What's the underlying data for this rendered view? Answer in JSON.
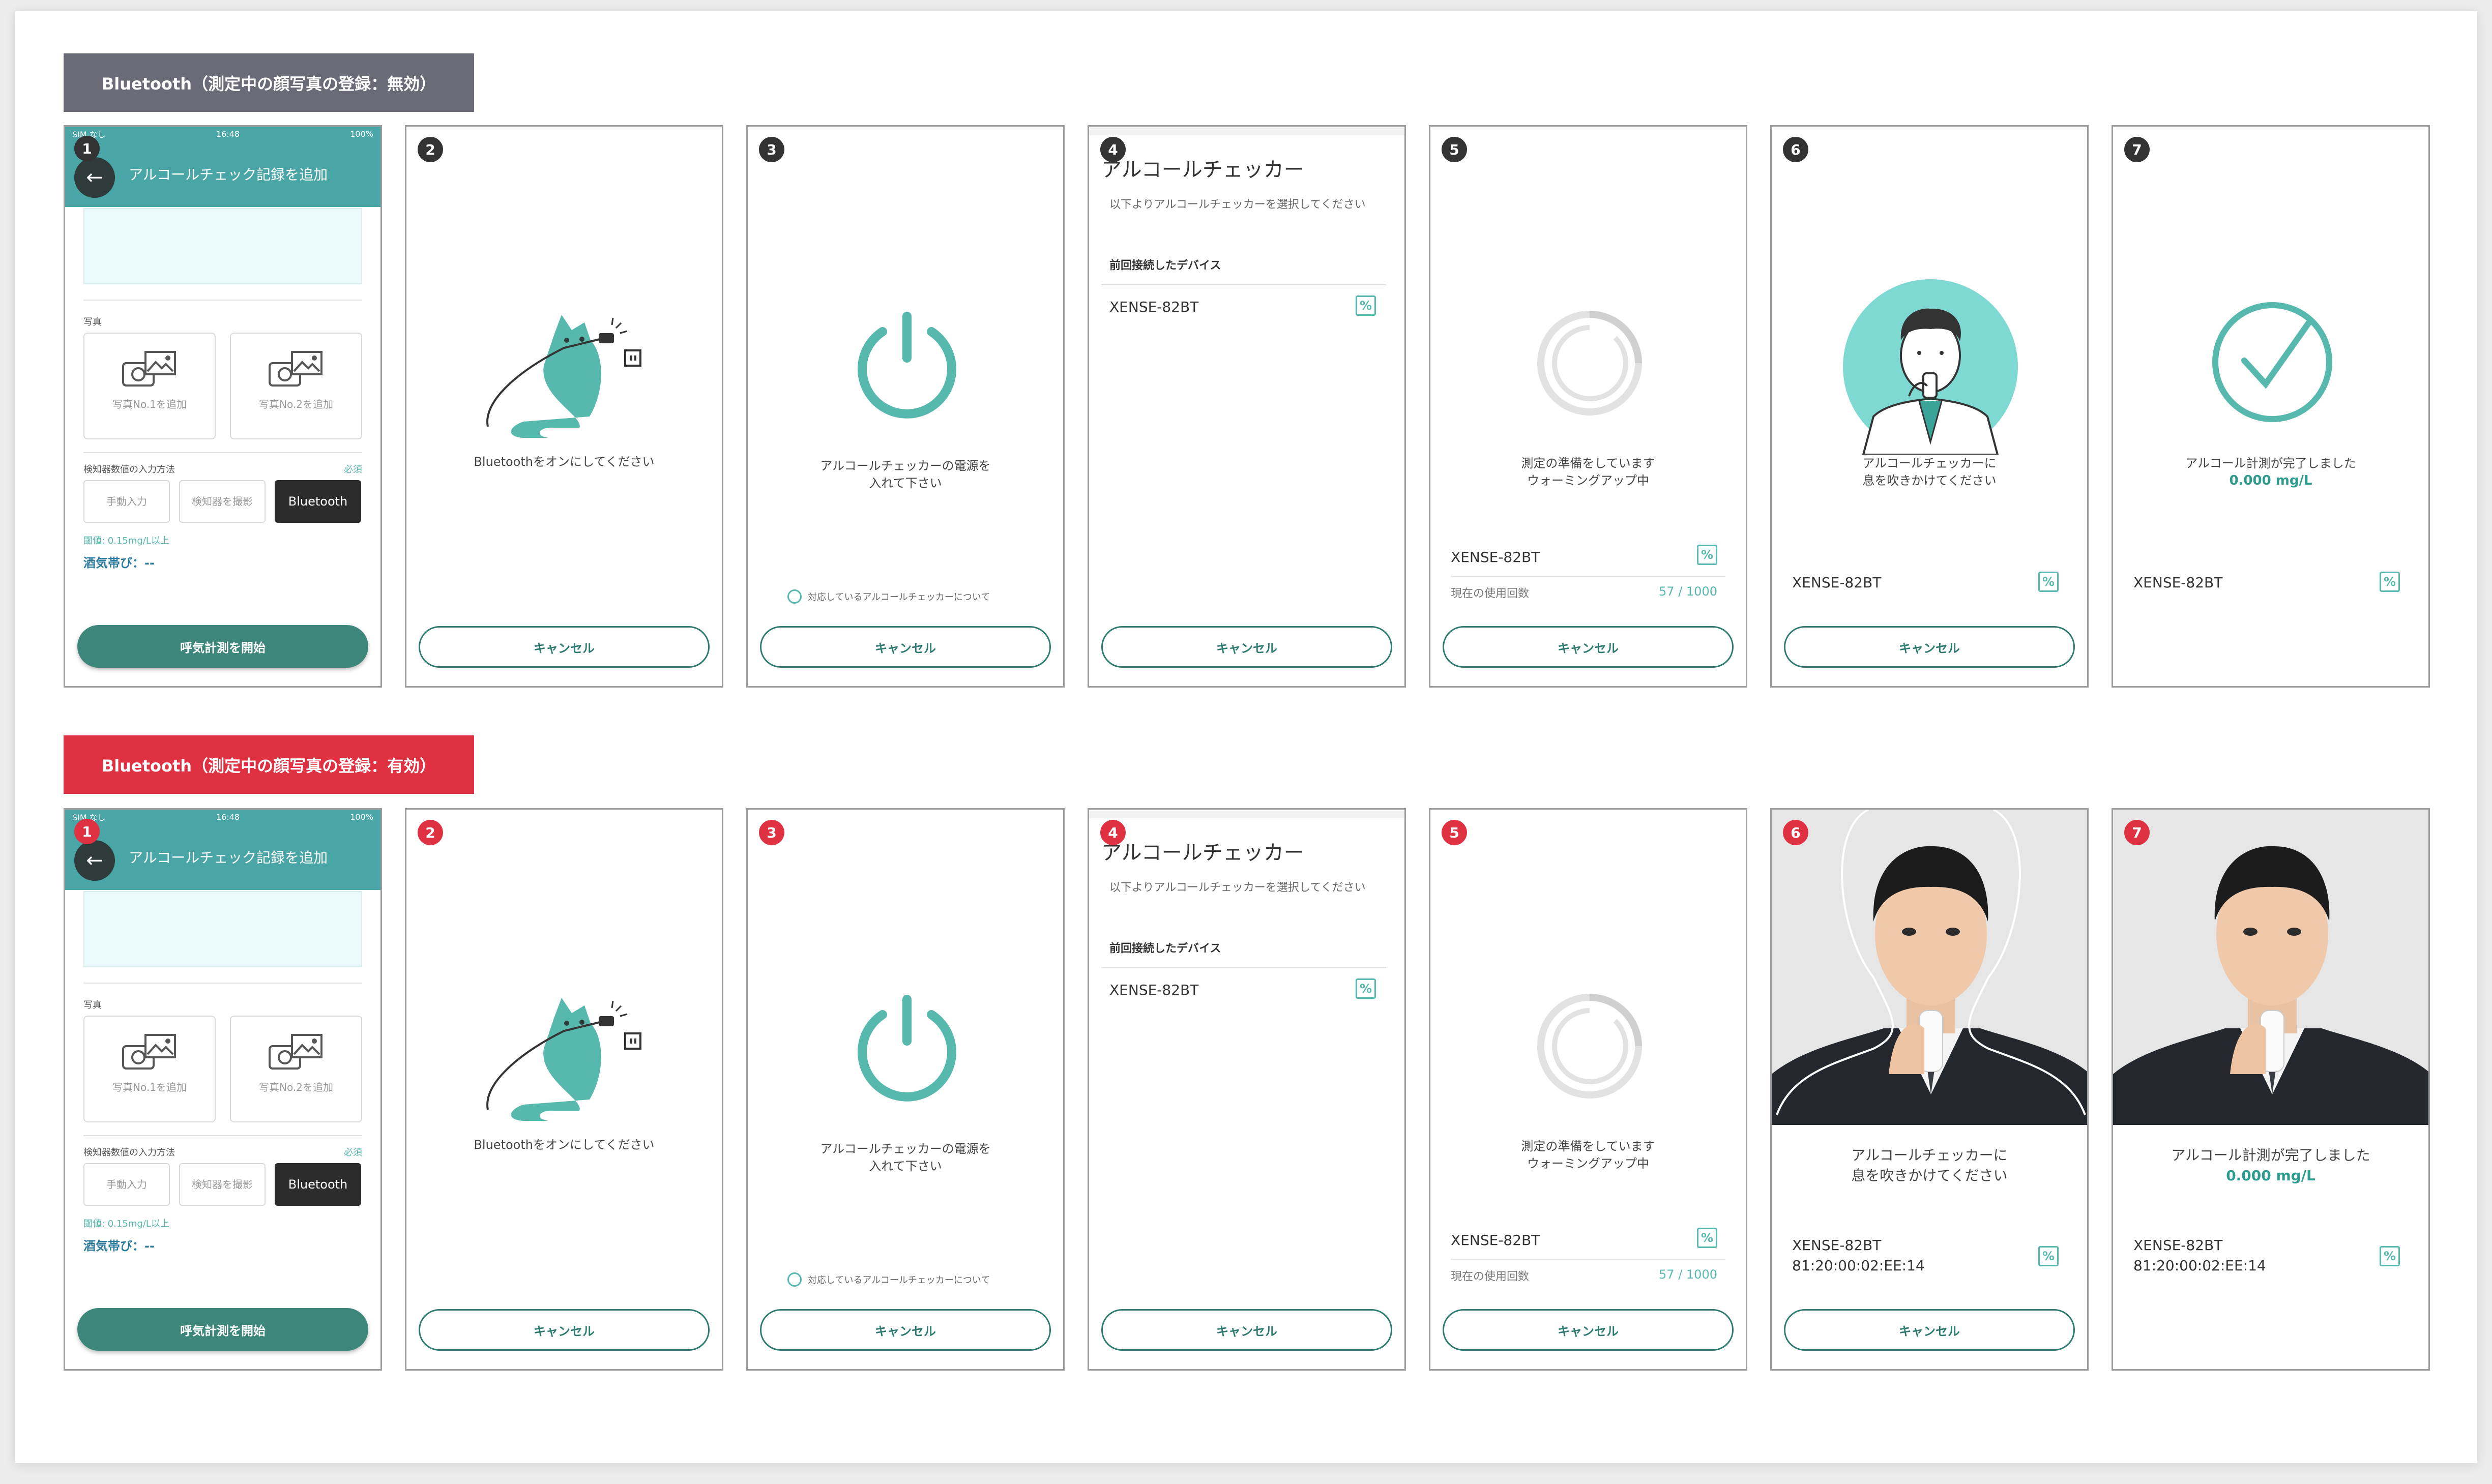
{
  "colors": {
    "tag_disabled": "#6b6b78",
    "tag_enabled": "#e03142",
    "badge_row1": "#333333",
    "badge_row2": "#e03142",
    "teal": "#57b8ad",
    "dark_teal": "#2c7b6e"
  },
  "rows": [
    {
      "tag": "Bluetooth（測定中の顔写真の登録：無効）",
      "badge_color": "#333333"
    },
    {
      "tag": "Bluetooth（測定中の顔写真の登録：有効）",
      "badge_color": "#e03142"
    }
  ],
  "steps": [
    "1",
    "2",
    "3",
    "4",
    "5",
    "6",
    "7"
  ],
  "screen1": {
    "status_left": "SIM なし",
    "status_time": "16:48",
    "status_right": "100%",
    "header_title": "アルコールチェック記録を追加",
    "photo_section": "写真",
    "photo1": "写真No.1を追加",
    "photo2": "写真No.2を追加",
    "input_method_label": "検知器数値の入力方法",
    "required": "必須",
    "manual": "手動入力",
    "capture": "検知器を撮影",
    "bluetooth": "Bluetooth",
    "threshold": "閾値: 0.15mg/L以上",
    "alcohol_zone": "酒気帯び：--",
    "start_button": "呼気計測を開始"
  },
  "screen2": {
    "caption": "Bluetoothをオンにしてください",
    "cancel": "キャンセル"
  },
  "screen3": {
    "caption": "アルコールチェッカーの電源を入れて下さい",
    "supported_link": "対応しているアルコールチェッカーについて",
    "cancel": "キャンセル"
  },
  "screen4": {
    "title": "アルコールチェッカー",
    "subtitle": "以下よりアルコールチェッカーを選択してください",
    "section": "前回接続したデバイス",
    "device": "XENSE-82BT",
    "cancel": "キャンセル"
  },
  "screen5": {
    "caption1": "測定の準備をしています",
    "caption2": "ウォーミングアップ中",
    "device": "XENSE-82BT",
    "usage_label": "現在の使用回数",
    "usage_value": "57 / 1000",
    "cancel": "キャンセル"
  },
  "screen6": {
    "caption1": "アルコールチェッカーに",
    "caption2": "息を吹きかけてください",
    "device": "XENSE-82BT",
    "mac": "81:20:00:02:EE:14",
    "cancel": "キャンセル"
  },
  "screen7": {
    "caption1": "アルコール計測が完了しました",
    "result": "0.000 mg/L",
    "device": "XENSE-82BT",
    "mac": "81:20:00:02:EE:14"
  },
  "icons": {
    "percent": "%",
    "back_arrow": "←"
  }
}
